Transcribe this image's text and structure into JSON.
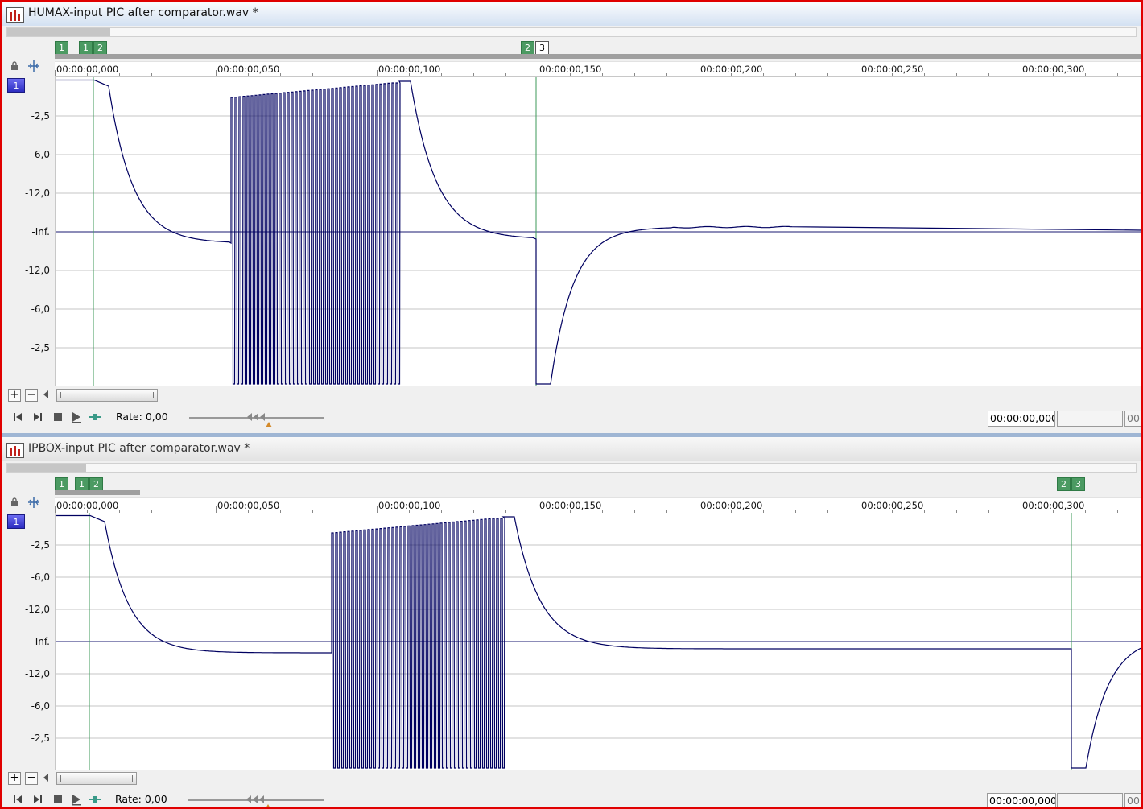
{
  "colors": {
    "frame": "#e00000",
    "waveform": "#000060",
    "marker": "#4b9a62",
    "channel": "#3a3ad8"
  },
  "ruler_labels": [
    "00:00:00,000",
    "00:00:00,050",
    "00:00:00,100",
    "00:00:00,150",
    "00:00:00,200",
    "00:00:00,250",
    "00:00:00,300"
  ],
  "scale_labels": [
    "-2,5",
    "-6,0",
    "-12,0",
    "-Inf.",
    "-12,0",
    "-6,0",
    "-2,5"
  ],
  "window1": {
    "title": "HUMAX-input PIC after comparator.wav *",
    "markers": [
      "1",
      "1",
      "2",
      "2",
      "3"
    ],
    "channel": "1",
    "rate": "Rate: 0,00",
    "time": "00:00:00,000",
    "time_partial": "00:"
  },
  "window2": {
    "title": "IPBOX-input PIC after comparator.wav *",
    "markers": [
      "1",
      "1",
      "2",
      "2",
      "3"
    ],
    "channel": "1",
    "rate": "Rate: 0,00",
    "time": "00:00:00,000",
    "time_partial": "00:"
  },
  "icons": [
    "app-icon",
    "lock-icon",
    "snap-icon",
    "zoom-in-icon",
    "zoom-out-icon",
    "scroll-left-icon",
    "go-start-icon",
    "go-end-icon",
    "stop-icon",
    "play-icon",
    "loop-icon",
    "slider-knob-icon"
  ]
}
